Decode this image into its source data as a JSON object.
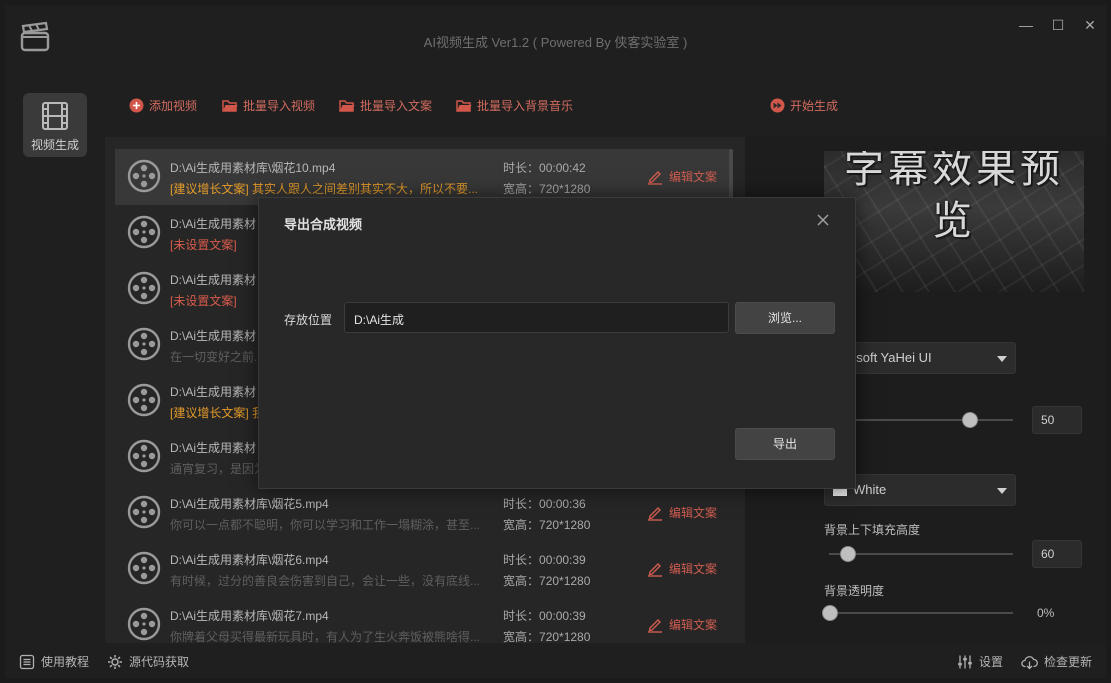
{
  "window": {
    "title": "AI视频生成 Ver1.2 ( Powered By 侠客实验室 )",
    "minimize_glyph": "—",
    "maximize_glyph": "☐",
    "close_glyph": "✕"
  },
  "nav": {
    "video_gen_label": "视频生成"
  },
  "toolbar": {
    "add_video": "添加视频",
    "batch_import_video": "批量导入视频",
    "batch_import_copy": "批量导入文案",
    "batch_import_bgm": "批量导入背景音乐",
    "start": "开始生成"
  },
  "list": {
    "duration_prefix": "时长：",
    "size_prefix": "宽高：",
    "edit_label": "编辑文案",
    "items": [
      {
        "path": "D:\\Ai生成用素材库\\烟花10.mp4",
        "desc": "[建议增长文案] 其实人跟人之间差别其实不大，所以不要...",
        "duration": "00:00:42",
        "size": "720*1280"
      },
      {
        "path": "D:\\Ai生成用素材",
        "desc": "[未设置文案]"
      },
      {
        "path": "D:\\Ai生成用素材",
        "desc": "[未设置文案]"
      },
      {
        "path": "D:\\Ai生成用素材",
        "desc": "在一切变好之前..."
      },
      {
        "path": "D:\\Ai生成用素材",
        "desc": "[建议增长文案] 我"
      },
      {
        "path": "D:\\Ai生成用素材",
        "desc": "通宵复习，是因为"
      },
      {
        "path": "D:\\Ai生成用素材库\\烟花5.mp4",
        "desc": "你可以一点都不聪明，你可以学习和工作一塌糊涂，甚至...",
        "duration": "00:00:36",
        "size": "720*1280"
      },
      {
        "path": "D:\\Ai生成用素材库\\烟花6.mp4",
        "desc": "有时候，过分的善良会伤害到自己，会让一些，没有底线...",
        "duration": "00:00:39",
        "size": "720*1280"
      },
      {
        "path": "D:\\Ai生成用素材库\\烟花7.mp4",
        "desc": "你牌着父母买得最新玩具时，有人为了生火奔饭被熊啥得...",
        "duration": "00:00:39",
        "size": "720*1280"
      }
    ]
  },
  "settings": {
    "preview_text": "字幕效果预览",
    "font_select": "osoft YaHei UI",
    "font_size_value": "50",
    "font_size_fraction": 0.76,
    "color_select": "White",
    "bg_padding_label": "背景上下填充高度",
    "bg_padding_value": "60",
    "bg_padding_fraction": 0.1,
    "bg_opacity_label": "背景透明度",
    "bg_opacity_value": "0%",
    "bg_opacity_fraction": 0.0
  },
  "modal": {
    "title": "导出合成视频",
    "location_label": "存放位置",
    "location_value": "D:\\Ai生成",
    "browse_label": "浏览...",
    "export_label": "导出"
  },
  "statusbar": {
    "tutorial": "使用教程",
    "source": "源代码获取",
    "settings": "设置",
    "update": "检查更新"
  }
}
